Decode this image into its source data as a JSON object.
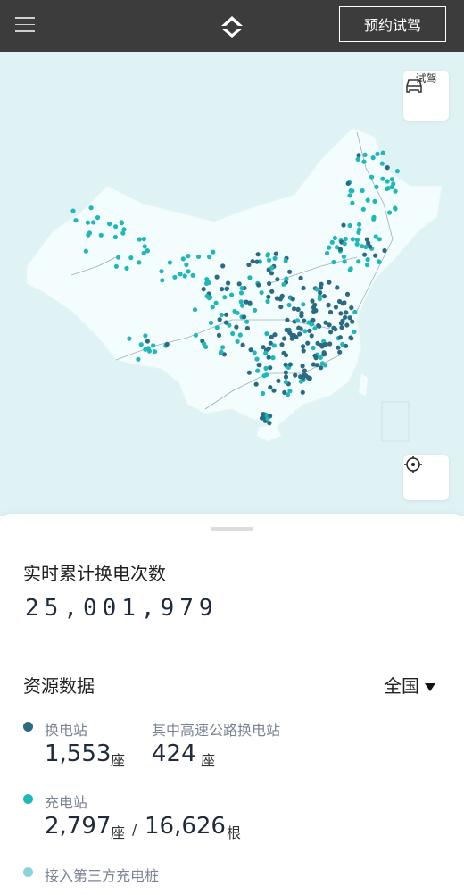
{
  "header": {
    "cta_label": "预约试驾"
  },
  "map": {
    "test_drive_label": "试驾",
    "colors": {
      "swap_station": "#2b6a82",
      "charge_station": "#1fb7b9",
      "third_party": "#8ad4dc",
      "land": "#f4fdfd",
      "sea": "#dff3f5"
    }
  },
  "realtime": {
    "title": "实时累计换电次数",
    "count": "25,001,979"
  },
  "resources": {
    "title": "资源数据",
    "region": "全国",
    "swap": {
      "label": "换电站",
      "count": "1,553",
      "unit": "座",
      "highway_label": "其中高速公路换电站",
      "highway_count": "424",
      "highway_unit": "座"
    },
    "charge": {
      "label": "充电站",
      "count": "2,797",
      "unit": "座",
      "sep": "/",
      "piles": "16,626",
      "piles_unit": "根"
    },
    "third_party": {
      "label": "接入第三方充电桩"
    }
  }
}
